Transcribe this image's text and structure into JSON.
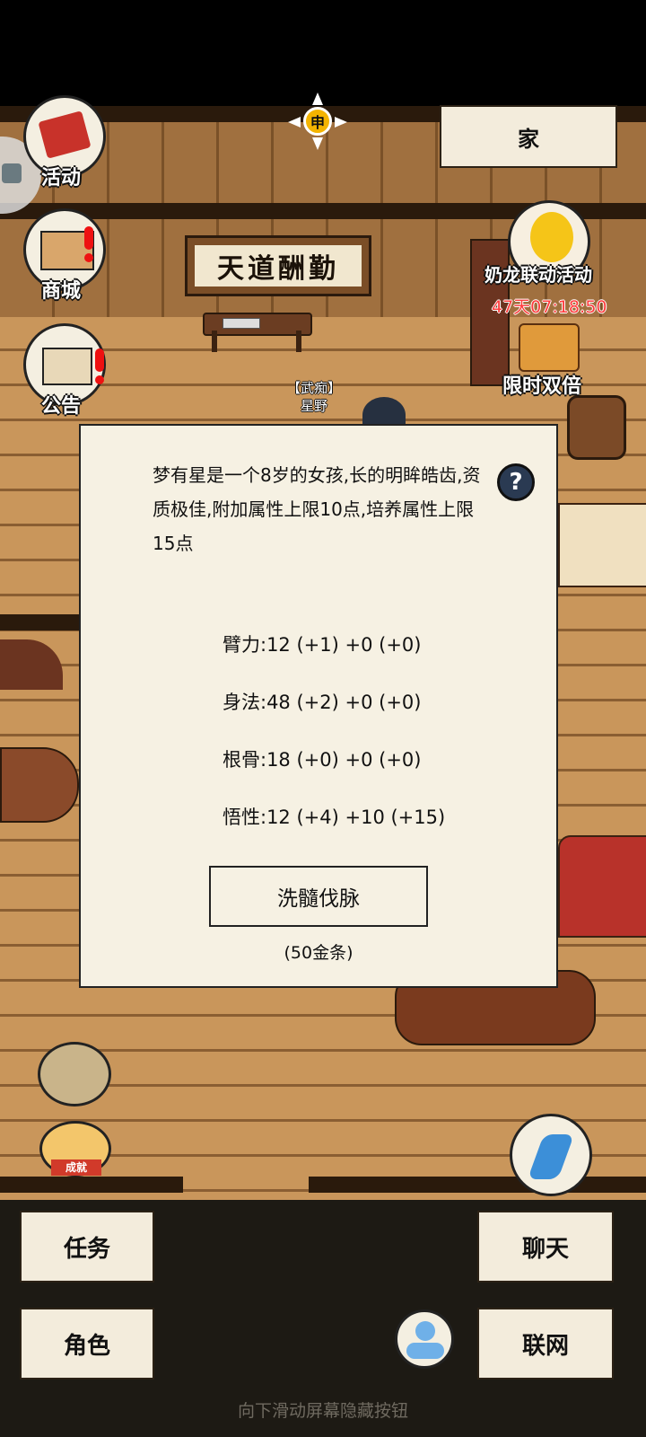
{
  "header": {
    "home_label": "家",
    "time_glyph": "申"
  },
  "left_menu": {
    "activity_label": "活动",
    "shop_label": "商城",
    "notice_label": "公告"
  },
  "event": {
    "title": "奶龙联动活动",
    "timer": "47天07:18:50",
    "double_label": "限时双倍"
  },
  "scene": {
    "sign_text": "天道酬勤",
    "npc_tag": "【武痴】",
    "npc_name": "星野"
  },
  "dialog": {
    "description": "梦有星是一个8岁的女孩,长的明眸皓齿,资质极佳,附加属性上限10点,培养属性上限15点",
    "help_glyph": "?",
    "stats": [
      {
        "text": "臂力:12 (+1) +0 (+0)"
      },
      {
        "text": "身法:48 (+2) +0 (+0)"
      },
      {
        "text": "根骨:18 (+0) +0 (+0)"
      },
      {
        "text": "悟性:12 (+4) +10 (+15)"
      }
    ],
    "action_label": "洗髓伐脉",
    "cost_label": "(50金条)"
  },
  "bottom": {
    "achievement_label": "成就",
    "task_label": "任务",
    "chat_label": "聊天",
    "role_label": "角色",
    "network_label": "联网",
    "hint": "向下滑动屏幕隐藏按钮"
  },
  "colors": {
    "timer": "#ff3a3a",
    "floor": "#c9965b",
    "panel": "#f6f1e3",
    "accent_gold": "#f4b400"
  }
}
